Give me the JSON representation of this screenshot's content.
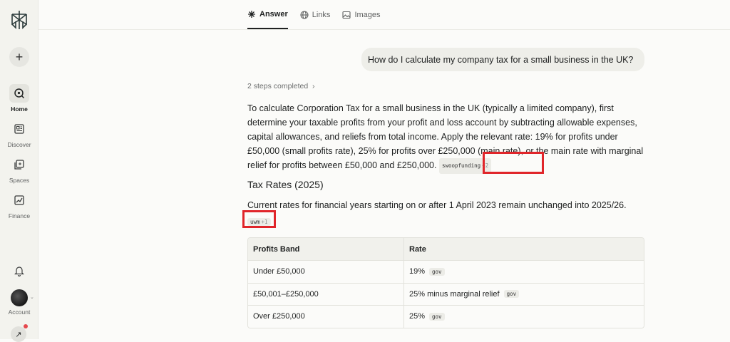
{
  "sidebar": {
    "nav": [
      {
        "label": "Home",
        "icon": "home-search-icon",
        "active": true
      },
      {
        "label": "Discover",
        "icon": "discover-icon",
        "active": false
      },
      {
        "label": "Spaces",
        "icon": "spaces-icon",
        "active": false
      },
      {
        "label": "Finance",
        "icon": "finance-icon",
        "active": false
      }
    ],
    "account_label": "Account"
  },
  "tabs": [
    {
      "label": "Answer",
      "icon": "answer-icon",
      "active": true
    },
    {
      "label": "Links",
      "icon": "globe-icon",
      "active": false
    },
    {
      "label": "Images",
      "icon": "image-icon",
      "active": false
    }
  ],
  "question": "How do I calculate my company tax for a small business in the UK?",
  "steps_text": "2 steps completed",
  "answer": {
    "paragraph1": "To calculate Corporation Tax for a small business in the UK (typically a limited company), first determine your taxable profits from your profit and loss account by subtracting allowable expenses, capital allowances, and reliefs from total income. Apply the relevant rate: 19% for profits under £50,000 (small profits rate), 25% for profits over £250,000 (main rate), or the main rate with marginal relief for profits between £50,000 and £250,000.",
    "citation1": {
      "source": "swoopfunding",
      "more": "+2"
    },
    "heading": "Tax Rates (2025)",
    "paragraph2": "Current rates for financial years starting on or after 1 April 2023 remain unchanged into 2025/26.",
    "citation2": {
      "source": "uwm",
      "more": "+1"
    }
  },
  "table": {
    "headers": [
      "Profits Band",
      "Rate"
    ],
    "rows": [
      {
        "band": "Under £50,000",
        "rate": "19%",
        "cite": "gov"
      },
      {
        "band": "£50,001–£250,000",
        "rate": "25% minus marginal relief",
        "cite": "gov"
      },
      {
        "band": "Over £250,000",
        "rate": "25%",
        "cite": "gov"
      }
    ]
  },
  "colors": {
    "accent_highlight": "#e0252a",
    "notification_dot": "#e5484d"
  }
}
